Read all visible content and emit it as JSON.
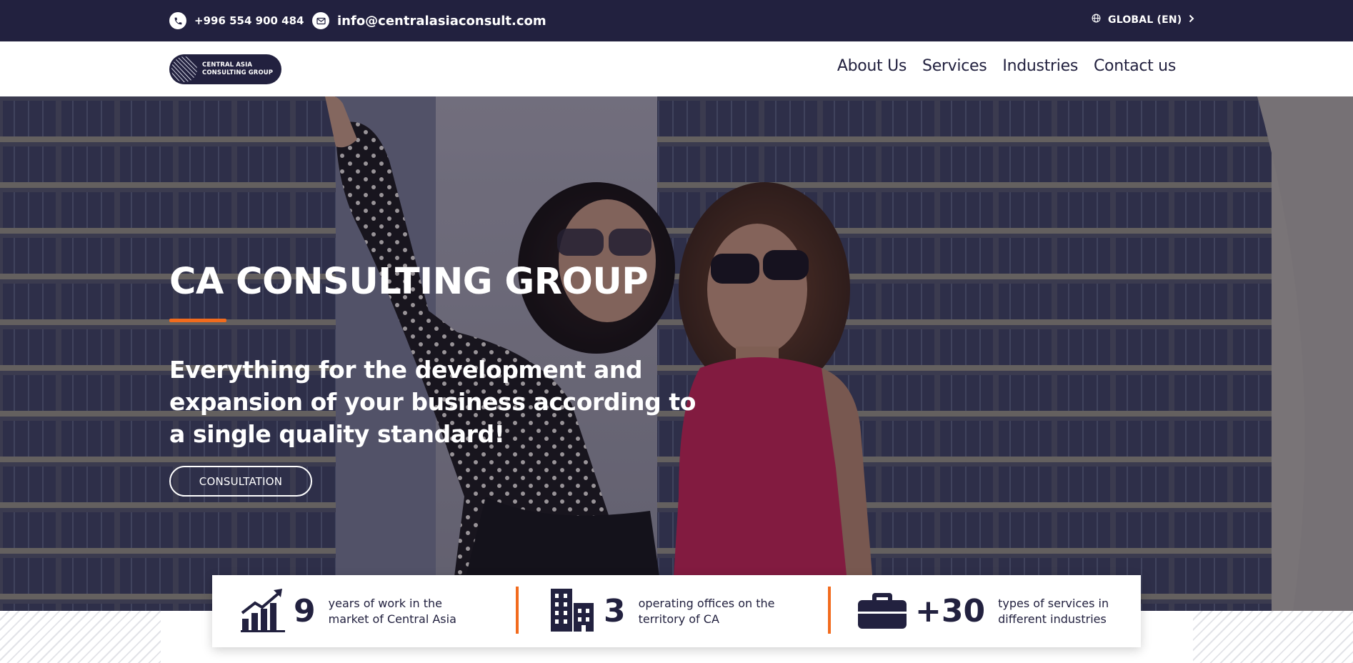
{
  "topbar": {
    "phone": "+996 554 900 484",
    "email": "info@centralasiaconsult.com",
    "language": "GLOBAL (EN)",
    "icons": {
      "phone": "phone-icon",
      "email": "mail-icon",
      "language": "globe-icon",
      "chevron": "chevron-right-icon"
    }
  },
  "logo": {
    "line1": "CENTRAL ASIA",
    "line2": "CONSULTING GROUP"
  },
  "nav": {
    "items": [
      "About Us",
      "Services",
      "Industries",
      "Contact us"
    ]
  },
  "hero": {
    "title": "CA CONSULTING GROUP",
    "subtitle": "Everything for the development and expansion of your business according to a single quality standard!",
    "cta": "CONSULTATION"
  },
  "stats": [
    {
      "icon": "growth-chart-icon",
      "value": "9",
      "text": "years of work in the market of Central Asia"
    },
    {
      "icon": "buildings-icon",
      "value": "3",
      "text": "operating offices on the territory of CA"
    },
    {
      "icon": "briefcase-icon",
      "value": "+30",
      "text": "types of services in different industries"
    }
  ],
  "colors": {
    "navy": "#22213f",
    "accent": "#f26b1d",
    "white": "#ffffff"
  }
}
